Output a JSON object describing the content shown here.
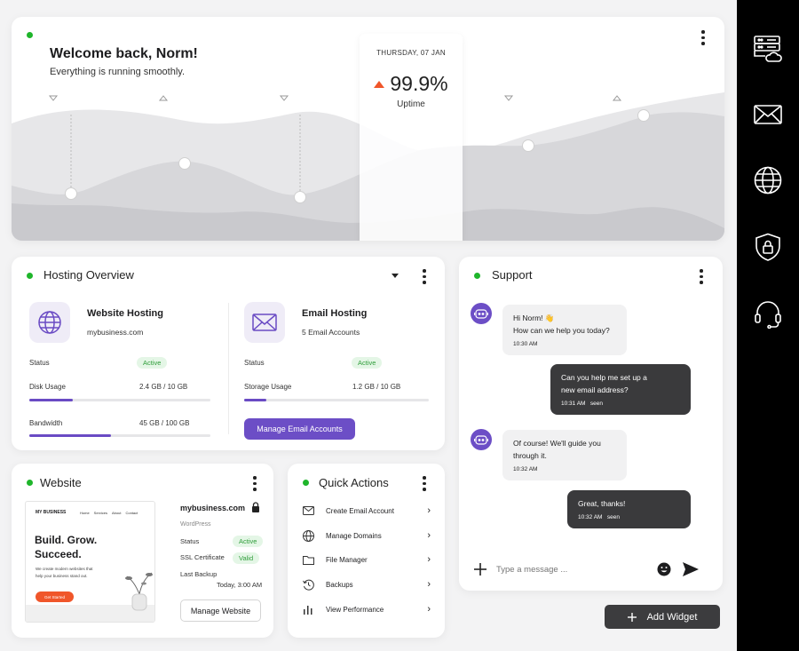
{
  "hero": {
    "title": "Welcome back, Norm!",
    "subtitle": "Everything is running smoothly.",
    "date": "THURSDAY, 07 JAN",
    "uptime_value": "99.9%",
    "uptime_label": "Uptime",
    "accent_color": "#f0562a"
  },
  "hosting": {
    "title": "Hosting Overview",
    "website": {
      "name": "Website Hosting",
      "domain": "mybusiness.com",
      "status_label": "Status",
      "status_value": "Active",
      "disk_label": "Disk Usage",
      "disk_value": "2.4 GB / 10 GB",
      "disk_fraction": 0.24,
      "bandwidth_label": "Bandwidth",
      "bandwidth_value": "45 GB / 100 GB",
      "bandwidth_fraction": 0.45
    },
    "email": {
      "name": "Email Hosting",
      "accounts": "5 Email Accounts",
      "status_label": "Status",
      "status_value": "Active",
      "storage_label": "Storage Usage",
      "storage_value": "1.2 GB / 10 GB",
      "storage_fraction": 0.12,
      "manage_button": "Manage Email Accounts"
    }
  },
  "website": {
    "title": "Website",
    "preview": {
      "brand": "MY BUSINESS",
      "nav": [
        "Home",
        "Services",
        "About",
        "Contact"
      ],
      "headline1": "Build. Grow.",
      "headline2": "Succeed.",
      "body1": "We create modern websites that",
      "body2": "help your business stand out.",
      "cta": "Get Started"
    },
    "domain": "mybusiness.com",
    "platform": "WordPress",
    "status_label": "Status",
    "status_value": "Active",
    "ssl_label": "SSL Certificate",
    "ssl_value": "Valid",
    "backup_label": "Last Backup",
    "backup_value": "Today, 3:00 AM",
    "manage_button": "Manage Website"
  },
  "quick_actions": {
    "title": "Quick Actions",
    "items": [
      {
        "label": "Create Email Account",
        "icon": "envelope-icon"
      },
      {
        "label": "Manage Domains",
        "icon": "globe-icon"
      },
      {
        "label": "File Manager",
        "icon": "folder-icon"
      },
      {
        "label": "Backups",
        "icon": "history-icon"
      },
      {
        "label": "View Performance",
        "icon": "bar-chart-icon"
      }
    ]
  },
  "support": {
    "title": "Support",
    "messages": [
      {
        "from": "bot",
        "line1": "Hi Norm! 👋",
        "line2": "How can we help you today?",
        "time": "10:30 AM"
      },
      {
        "from": "user",
        "line1": "Can you help me set up a",
        "line2": "new email address?",
        "time": "10:31 AM",
        "seen": "seen"
      },
      {
        "from": "bot",
        "line1": "Of course! We'll guide you",
        "line2": "through it.",
        "time": "10:32 AM"
      },
      {
        "from": "user",
        "line1": "Great, thanks!",
        "line2": "",
        "time": "10:32 AM",
        "seen": "seen"
      }
    ],
    "input_placeholder": "Type a message ..."
  },
  "add_widget": "Add Widget",
  "rail_icons": [
    "server-cloud-icon",
    "mail-icon",
    "globe-icon",
    "security-shield-icon",
    "headset-icon"
  ]
}
